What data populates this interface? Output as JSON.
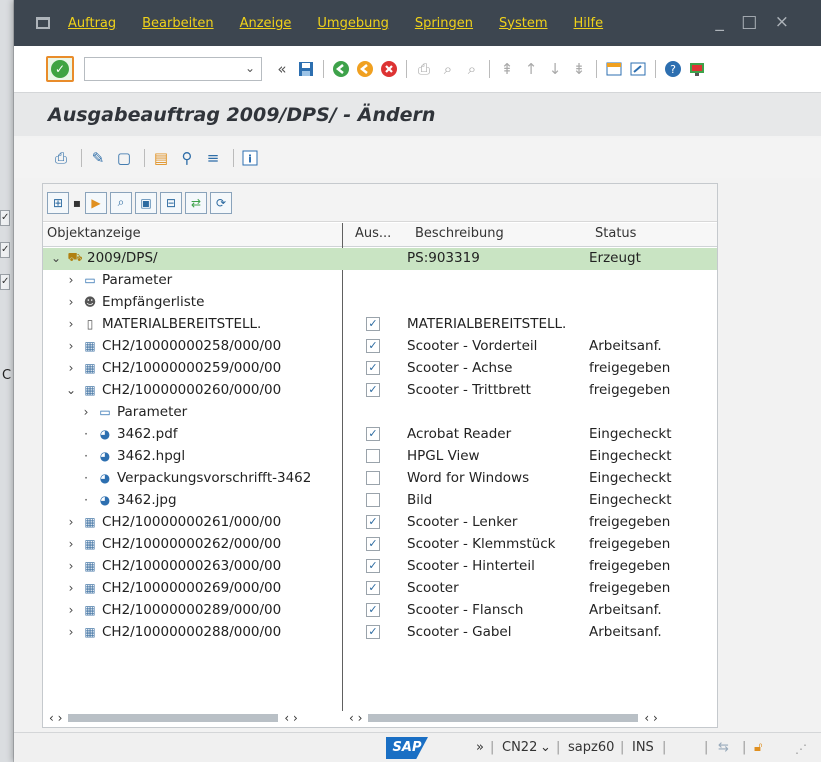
{
  "menu": {
    "items": [
      "Auftrag",
      "Bearbeiten",
      "Anzeige",
      "Umgebung",
      "Springen",
      "System",
      "Hilfe"
    ],
    "window_controls": "_ □ ×"
  },
  "toolbar": {
    "ok_symbol": "✓",
    "command_placeholder": "",
    "dropdown": "⌄",
    "collapse": "«"
  },
  "title": "Ausgabeauftrag 2009/DPS/ - Ändern",
  "tree": {
    "headers": {
      "object": "Objektanzeige",
      "output": "Aus...",
      "description": "Beschreibung",
      "status": "Status"
    },
    "rows": [
      {
        "level": 0,
        "arrow": "⌄",
        "icon": "order-icon",
        "label": "2009/DPS/",
        "checked": null,
        "desc": "PS:903319",
        "status": "Erzeugt",
        "selected": true
      },
      {
        "level": 1,
        "arrow": "›",
        "icon": "parameter-icon",
        "label": "Parameter",
        "checked": null,
        "desc": "",
        "status": "",
        "selected": false
      },
      {
        "level": 1,
        "arrow": "›",
        "icon": "recipients-icon",
        "label": "Empfängerliste",
        "checked": null,
        "desc": "",
        "status": "",
        "selected": false
      },
      {
        "level": 1,
        "arrow": "›",
        "icon": "document-icon",
        "label": "MATERIALBEREITSTELL.",
        "checked": true,
        "desc": "MATERIALBEREITSTELL.",
        "status": "",
        "selected": false
      },
      {
        "level": 1,
        "arrow": "›",
        "icon": "dms-document-icon",
        "label": "CH2/10000000258/000/00",
        "checked": true,
        "desc": "Scooter - Vorderteil",
        "status": "Arbeitsanf.",
        "selected": false
      },
      {
        "level": 1,
        "arrow": "›",
        "icon": "dms-document-icon",
        "label": "CH2/10000000259/000/00",
        "checked": true,
        "desc": "Scooter - Achse",
        "status": "freigegeben",
        "selected": false
      },
      {
        "level": 1,
        "arrow": "⌄",
        "icon": "dms-document-icon",
        "label": "CH2/10000000260/000/00",
        "checked": true,
        "desc": "Scooter - Trittbrett",
        "status": "freigegeben",
        "selected": false
      },
      {
        "level": 2,
        "arrow": "›",
        "icon": "parameter-icon",
        "label": "Parameter",
        "checked": null,
        "desc": "",
        "status": "",
        "selected": false
      },
      {
        "level": 2,
        "arrow": "·",
        "icon": "original-file-icon",
        "label": "3462.pdf",
        "checked": true,
        "desc": "Acrobat Reader",
        "status": "Eingecheckt",
        "selected": false
      },
      {
        "level": 2,
        "arrow": "·",
        "icon": "original-file-icon",
        "label": "3462.hpgl",
        "checked": false,
        "desc": "HPGL View",
        "status": "Eingecheckt",
        "selected": false
      },
      {
        "level": 2,
        "arrow": "·",
        "icon": "original-file-icon",
        "label": "Verpackungsvorschrifft-3462",
        "checked": false,
        "desc": "Word for Windows",
        "status": "Eingecheckt",
        "selected": false
      },
      {
        "level": 2,
        "arrow": "·",
        "icon": "original-file-icon",
        "label": "3462.jpg",
        "checked": false,
        "desc": "Bild",
        "status": "Eingecheckt",
        "selected": false
      },
      {
        "level": 1,
        "arrow": "›",
        "icon": "dms-document-icon",
        "label": "CH2/10000000261/000/00",
        "checked": true,
        "desc": "Scooter - Lenker",
        "status": "freigegeben",
        "selected": false
      },
      {
        "level": 1,
        "arrow": "›",
        "icon": "dms-document-icon",
        "label": "CH2/10000000262/000/00",
        "checked": true,
        "desc": "Scooter - Klemmstück",
        "status": "freigegeben",
        "selected": false
      },
      {
        "level": 1,
        "arrow": "›",
        "icon": "dms-document-icon",
        "label": "CH2/10000000263/000/00",
        "checked": true,
        "desc": "Scooter - Hinterteil",
        "status": "freigegeben",
        "selected": false
      },
      {
        "level": 1,
        "arrow": "›",
        "icon": "dms-document-icon",
        "label": "CH2/10000000269/000/00",
        "checked": true,
        "desc": "Scooter",
        "status": "freigegeben",
        "selected": false
      },
      {
        "level": 1,
        "arrow": "›",
        "icon": "dms-document-icon",
        "label": "CH2/10000000289/000/00",
        "checked": true,
        "desc": "Scooter - Flansch",
        "status": "Arbeitsanf.",
        "selected": false
      },
      {
        "level": 1,
        "arrow": "›",
        "icon": "dms-document-icon",
        "label": "CH2/10000000288/000/00",
        "checked": true,
        "desc": "Scooter - Gabel",
        "status": "Arbeitsanf.",
        "selected": false
      }
    ],
    "scroll_left": "‹  ›",
    "scroll_right": "‹  ›"
  },
  "statusbar": {
    "logo": "SAP",
    "expand": "»",
    "transaction": "CN22",
    "server": "sapz60",
    "mode": "INS"
  },
  "background": {
    "letter": "C"
  },
  "colors": {
    "menu_bg": "#3d4650",
    "menu_text": "#f0d21a",
    "selected_row": "#c9e4c3",
    "sap_blue": "#1a6fc4"
  }
}
